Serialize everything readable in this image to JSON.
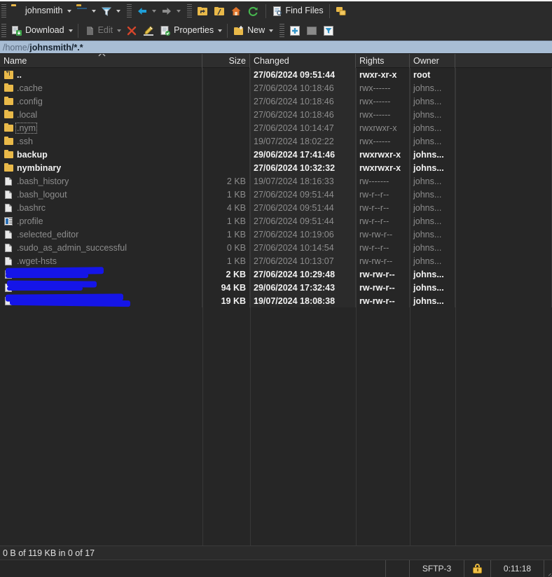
{
  "window": {
    "title": "johnsmith"
  },
  "toolbar_top": {
    "session_button": {
      "label": "johnsmith",
      "icon": "folder-icon"
    },
    "open_session_button": {
      "icon": "open-folder-icon"
    },
    "filter_button": {
      "icon": "filter-funnel-icon"
    },
    "back_button": {
      "icon": "arrow-left-icon"
    },
    "forward_button": {
      "icon": "arrow-right-icon"
    },
    "parent_dir_button": {
      "icon": "folder-up-icon"
    },
    "root_dir_button": {
      "icon": "folder-root-icon"
    },
    "home_dir_button": {
      "icon": "home-icon"
    },
    "refresh_button": {
      "icon": "refresh-icon"
    },
    "find_files_button": {
      "label": "Find Files",
      "icon": "document-search-icon"
    },
    "copy_queue_button": {
      "icon": "copy-folders-icon"
    }
  },
  "toolbar_second": {
    "download_button": {
      "label": "Download",
      "icon": "download-icon",
      "enabled": true
    },
    "edit_button": {
      "label": "Edit",
      "icon": "edit-icon",
      "enabled": false
    },
    "delete_button": {
      "icon": "delete-x-icon"
    },
    "rename_button": {
      "icon": "rename-pencil-icon"
    },
    "properties_button": {
      "label": "Properties",
      "icon": "properties-icon"
    },
    "new_button": {
      "label": "New",
      "icon": "new-folder-icon"
    },
    "add_button": {
      "icon": "plus-icon"
    },
    "blank_button": {
      "icon": "grey-square-icon"
    },
    "filter_apply_button": {
      "icon": "funnel-blue-icon"
    }
  },
  "address_bar": {
    "prefix": "/home/",
    "path": "johnsmith/*.*",
    "full": "/home/johnsmith/*.*"
  },
  "file_list": {
    "sort_column": "Name",
    "sort_direction": "ascending",
    "columns": [
      {
        "key": "name",
        "label": "Name",
        "align": "left"
      },
      {
        "key": "size",
        "label": "Size",
        "align": "right"
      },
      {
        "key": "changed",
        "label": "Changed",
        "align": "left"
      },
      {
        "key": "rights",
        "label": "Rights",
        "align": "left"
      },
      {
        "key": "owner",
        "label": "Owner",
        "align": "left"
      }
    ],
    "rows": [
      {
        "name": "..",
        "icon": "folder-up-icon",
        "size": "",
        "changed": "27/06/2024 09:51:44",
        "rights": "rwxr-xr-x",
        "owner": "root",
        "style": "normal",
        "focused": false,
        "redacted": false
      },
      {
        "name": ".cache",
        "icon": "folder-icon",
        "size": "",
        "changed": "27/06/2024 10:18:46",
        "rights": "rwx------",
        "owner": "johns...",
        "style": "hidden",
        "focused": false,
        "redacted": false
      },
      {
        "name": ".config",
        "icon": "folder-icon",
        "size": "",
        "changed": "27/06/2024 10:18:46",
        "rights": "rwx------",
        "owner": "johns...",
        "style": "hidden",
        "focused": false,
        "redacted": false
      },
      {
        "name": ".local",
        "icon": "folder-icon",
        "size": "",
        "changed": "27/06/2024 10:18:46",
        "rights": "rwx------",
        "owner": "johns...",
        "style": "hidden",
        "focused": false,
        "redacted": false
      },
      {
        "name": ".nym",
        "icon": "folder-icon",
        "size": "",
        "changed": "27/06/2024 10:14:47",
        "rights": "rwxrwxr-x",
        "owner": "johns...",
        "style": "hidden",
        "focused": true,
        "redacted": false
      },
      {
        "name": ".ssh",
        "icon": "folder-icon",
        "size": "",
        "changed": "19/07/2024 18:02:22",
        "rights": "rwx------",
        "owner": "johns...",
        "style": "hidden",
        "focused": false,
        "redacted": false
      },
      {
        "name": "backup",
        "icon": "folder-icon",
        "size": "",
        "changed": "29/06/2024 17:41:46",
        "rights": "rwxrwxr-x",
        "owner": "johns...",
        "style": "bold",
        "focused": false,
        "redacted": false
      },
      {
        "name": "nymbinary",
        "icon": "folder-icon",
        "size": "",
        "changed": "27/06/2024 10:32:32",
        "rights": "rwxrwxr-x",
        "owner": "johns...",
        "style": "bold",
        "focused": false,
        "redacted": false
      },
      {
        "name": ".bash_history",
        "icon": "file-icon",
        "size": "2 KB",
        "changed": "19/07/2024 18:16:33",
        "rights": "rw-------",
        "owner": "johns...",
        "style": "hidden",
        "focused": false,
        "redacted": false
      },
      {
        "name": ".bash_logout",
        "icon": "file-icon",
        "size": "1 KB",
        "changed": "27/06/2024 09:51:44",
        "rights": "rw-r--r--",
        "owner": "johns...",
        "style": "hidden",
        "focused": false,
        "redacted": false
      },
      {
        "name": ".bashrc",
        "icon": "file-icon",
        "size": "4 KB",
        "changed": "27/06/2024 09:51:44",
        "rights": "rw-r--r--",
        "owner": "johns...",
        "style": "hidden",
        "focused": false,
        "redacted": false
      },
      {
        "name": ".profile",
        "icon": "config-file-icon",
        "size": "1 KB",
        "changed": "27/06/2024 09:51:44",
        "rights": "rw-r--r--",
        "owner": "johns...",
        "style": "hidden",
        "focused": false,
        "redacted": false
      },
      {
        "name": ".selected_editor",
        "icon": "file-icon",
        "size": "1 KB",
        "changed": "27/06/2024 10:19:06",
        "rights": "rw-rw-r--",
        "owner": "johns...",
        "style": "hidden",
        "focused": false,
        "redacted": false
      },
      {
        "name": ".sudo_as_admin_successful",
        "icon": "file-icon",
        "size": "0 KB",
        "changed": "27/06/2024 10:14:54",
        "rights": "rw-r--r--",
        "owner": "johns...",
        "style": "hidden",
        "focused": false,
        "redacted": false
      },
      {
        "name": ".wget-hsts",
        "icon": "file-icon",
        "size": "1 KB",
        "changed": "27/06/2024 10:13:07",
        "rights": "rw-rw-r--",
        "owner": "johns...",
        "style": "hidden",
        "focused": false,
        "redacted": false
      },
      {
        "name": "",
        "icon": "file-icon",
        "size": "2 KB",
        "changed": "27/06/2024 10:29:48",
        "rights": "rw-rw-r--",
        "owner": "johns...",
        "style": "bold",
        "focused": false,
        "redacted": true
      },
      {
        "name": "",
        "icon": "file-icon",
        "size": "94 KB",
        "changed": "29/06/2024 17:32:43",
        "rights": "rw-rw-r--",
        "owner": "johns...",
        "style": "bold",
        "focused": false,
        "redacted": true
      },
      {
        "name": "",
        "icon": "file-icon",
        "size": "19 KB",
        "changed": "19/07/2024 18:08:38",
        "rights": "rw-rw-r--",
        "owner": "johns...",
        "style": "bold",
        "focused": false,
        "redacted": true
      }
    ]
  },
  "status_bar": {
    "selection_summary": "0 B of 119 KB in 0 of 17"
  },
  "bottom_bar": {
    "protocol": "SFTP-3",
    "encryption_icon": "padlock-icon",
    "session_duration": "0:11:18"
  },
  "colors": {
    "accent_folder": "#e9b949",
    "address_bar_bg": "#a8bdd4",
    "panel_bg": "#262626",
    "toolbar_bg": "#2b2b2b",
    "redaction": "#1515e8",
    "padlock": "#f0c14b"
  }
}
